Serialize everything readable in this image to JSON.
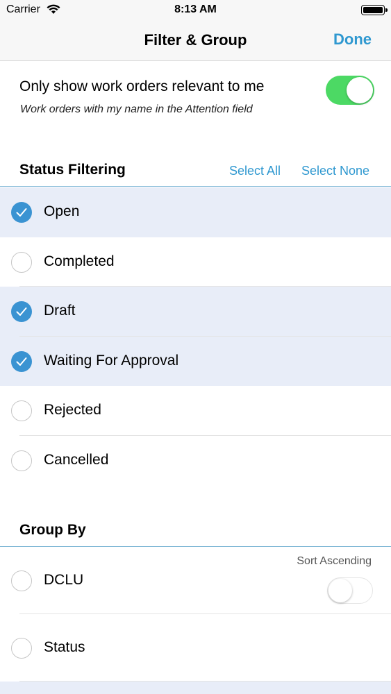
{
  "status_bar": {
    "carrier": "Carrier",
    "time": "8:13 AM"
  },
  "nav": {
    "title": "Filter & Group",
    "done_label": "Done"
  },
  "relevance": {
    "label": "Only show work orders relevant to me",
    "sublabel": "Work orders with my name in the Attention field",
    "enabled": true
  },
  "status_filtering": {
    "heading": "Status Filtering",
    "select_all_label": "Select All",
    "select_none_label": "Select None",
    "items": [
      {
        "label": "Open",
        "selected": true
      },
      {
        "label": "Completed",
        "selected": false
      },
      {
        "label": "Draft",
        "selected": true
      },
      {
        "label": "Waiting For Approval",
        "selected": true
      },
      {
        "label": "Rejected",
        "selected": false
      },
      {
        "label": "Cancelled",
        "selected": false
      }
    ]
  },
  "group_by": {
    "heading": "Group By",
    "sort_ascending_label": "Sort Ascending",
    "sort_ascending": false,
    "items": [
      {
        "label": "DCLU",
        "selected": false
      },
      {
        "label": "Status",
        "selected": false
      }
    ]
  },
  "colors": {
    "accent": "#2f98d0",
    "toggle_on": "#4cd964",
    "selected_row": "#e8edf8",
    "checkmark_fill": "#3a93d2"
  }
}
